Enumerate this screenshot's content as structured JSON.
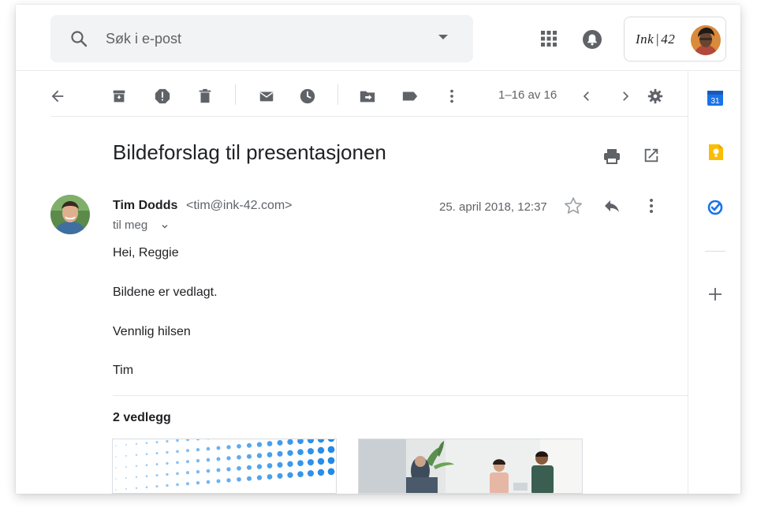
{
  "search": {
    "placeholder": "Søk i e-post"
  },
  "account": {
    "brand": "Ink | 42"
  },
  "toolbar": {
    "pager": "1–16 av 16"
  },
  "message": {
    "subject": "Bildeforslag til presentasjonen",
    "sender_name": "Tim Dodds",
    "sender_email": "<tim@ink-42.com>",
    "to_line": "til meg",
    "date": "25. april 2018, 12:37",
    "body": [
      "Hei, Reggie",
      "Bildene er vedlagt.",
      "Vennlig hilsen",
      "Tim"
    ]
  },
  "attachments": {
    "title": "2 vedlegg"
  },
  "side_panel": {
    "calendar_day": "31"
  },
  "colors": {
    "calendar_blue": "#1a73e8",
    "keep_yellow": "#fbbc04",
    "tasks_blue": "#1a73e8",
    "icon_gray": "#5f6368",
    "dot_blue": "#1e88e5"
  }
}
